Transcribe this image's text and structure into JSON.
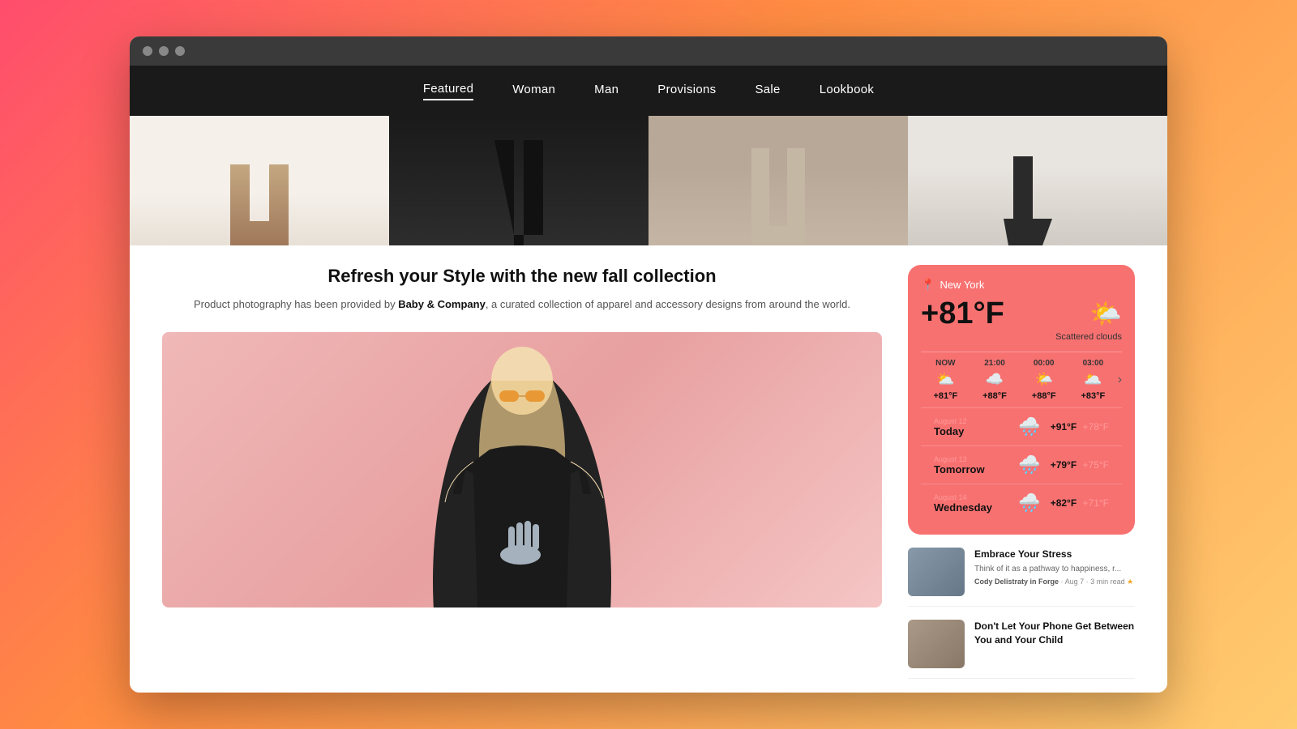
{
  "browser": {
    "dots": [
      "dot1",
      "dot2",
      "dot3"
    ]
  },
  "nav": {
    "items": [
      {
        "label": "Featured",
        "active": true
      },
      {
        "label": "Woman",
        "active": false
      },
      {
        "label": "Man",
        "active": false
      },
      {
        "label": "Provisions",
        "active": false
      },
      {
        "label": "Sale",
        "active": false
      },
      {
        "label": "Lookbook",
        "active": false
      }
    ]
  },
  "article": {
    "title": "Refresh your Style with the new fall collection",
    "desc_prefix": "Product photography has been provided by ",
    "desc_brand": "Baby & Company",
    "desc_suffix": ", a curated collection of apparel and accessory designs from around the world."
  },
  "weather": {
    "location": "New York",
    "temperature": "+81°F",
    "description": "Scattered clouds",
    "hourly": [
      {
        "time": "NOW",
        "icon": "⛅",
        "temp": "+81°F"
      },
      {
        "time": "21:00",
        "icon": "☁️",
        "temp": "+88°F"
      },
      {
        "time": "00:00",
        "icon": "🌤️",
        "temp": "+88°F"
      },
      {
        "time": "03:00",
        "icon": "🌥️",
        "temp": "+83°F"
      }
    ],
    "daily": [
      {
        "date_label": "August 12",
        "day": "Today",
        "icon": "🌧️",
        "high": "+91°F",
        "low": "+78°F"
      },
      {
        "date_label": "August 13",
        "day": "Tomorrow",
        "icon": "🌧️",
        "high": "+79°F",
        "low": "+75°F"
      },
      {
        "date_label": "August 14",
        "day": "Wednesday",
        "icon": "🌧️",
        "high": "+82°F",
        "low": "+71°F"
      }
    ]
  },
  "blog": {
    "articles": [
      {
        "title": "Embrace Your Stress",
        "excerpt": "Think of it as a pathway to happiness, r...",
        "author": "Cody Delistraty in Forge",
        "date": "Aug 7 · 3 min read",
        "starred": true
      },
      {
        "title": "Don't Let Your Phone Get Between You and Your Child",
        "excerpt": "",
        "author": "",
        "date": "",
        "starred": false
      }
    ]
  }
}
